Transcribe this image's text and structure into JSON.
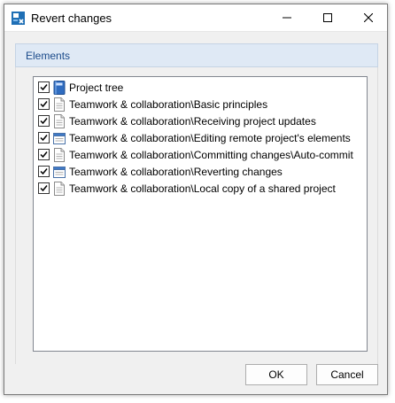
{
  "window": {
    "title": "Revert changes",
    "app_icon": "app-logo-icon",
    "controls": [
      "minimize-icon",
      "maximize-icon",
      "close-icon"
    ]
  },
  "group": {
    "label": "Elements"
  },
  "tree": {
    "items": [
      {
        "label": "Project tree",
        "checked": true,
        "icon": "project-book-icon"
      },
      {
        "label": "Teamwork & collaboration\\Basic principles",
        "checked": true,
        "icon": "document-icon"
      },
      {
        "label": "Teamwork & collaboration\\Receiving project updates",
        "checked": true,
        "icon": "document-icon"
      },
      {
        "label": "Teamwork & collaboration\\Editing remote project's elements",
        "checked": true,
        "icon": "window-page-icon"
      },
      {
        "label": "Teamwork & collaboration\\Committing changes\\Auto-commit",
        "checked": true,
        "icon": "document-icon"
      },
      {
        "label": "Teamwork & collaboration\\Reverting changes",
        "checked": true,
        "icon": "window-page-icon"
      },
      {
        "label": "Teamwork & collaboration\\Local copy of a shared project",
        "checked": true,
        "icon": "document-icon"
      }
    ]
  },
  "buttons": {
    "ok": "OK",
    "cancel": "Cancel"
  },
  "colors": {
    "group_header_bg": "#dfe9f5",
    "group_header_text": "#1a4a8a",
    "window_bg": "#f0f0f0"
  }
}
